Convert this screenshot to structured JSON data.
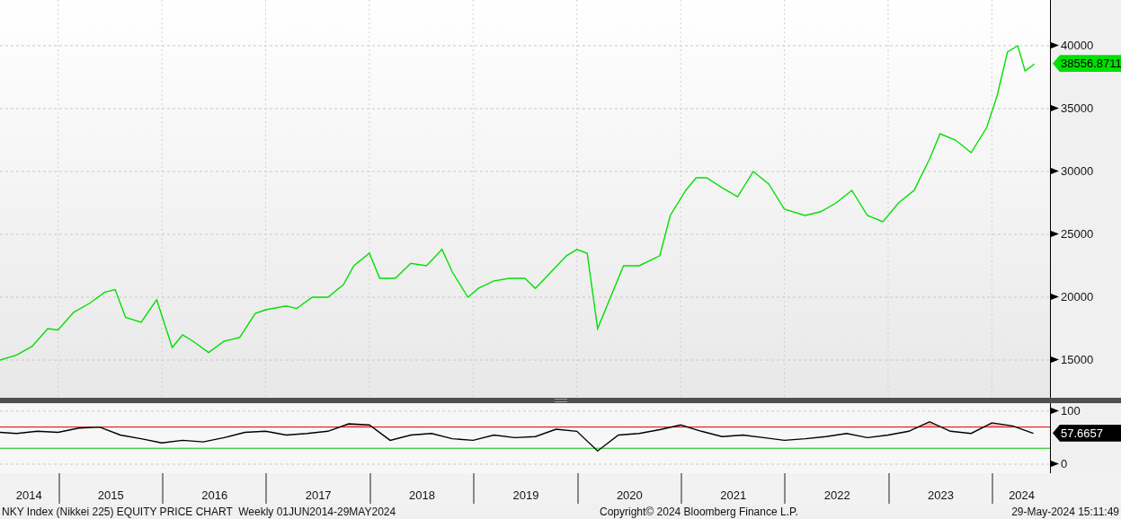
{
  "price_chart": {
    "last_value": "38556.8711",
    "chart_data": {
      "type": "line",
      "xlim": [
        2014.44,
        2024.56
      ],
      "ylim": [
        12000,
        43640
      ],
      "yticks": [
        15000,
        20000,
        25000,
        30000,
        35000,
        40000
      ],
      "grid": true,
      "x": [
        2014.44,
        2014.6,
        2014.75,
        2014.9,
        2015.0,
        2015.15,
        2015.3,
        2015.45,
        2015.55,
        2015.65,
        2015.8,
        2015.95,
        2016.1,
        2016.2,
        2016.3,
        2016.45,
        2016.6,
        2016.75,
        2016.9,
        2017.0,
        2017.2,
        2017.3,
        2017.45,
        2017.6,
        2017.75,
        2017.85,
        2018.0,
        2018.1,
        2018.25,
        2018.4,
        2018.55,
        2018.7,
        2018.8,
        2018.95,
        2019.05,
        2019.2,
        2019.35,
        2019.5,
        2019.6,
        2019.75,
        2019.9,
        2020.0,
        2020.1,
        2020.2,
        2020.3,
        2020.45,
        2020.6,
        2020.8,
        2020.9,
        2021.05,
        2021.15,
        2021.25,
        2021.4,
        2021.55,
        2021.7,
        2021.85,
        2022.0,
        2022.2,
        2022.35,
        2022.5,
        2022.65,
        2022.8,
        2022.95,
        2023.1,
        2023.25,
        2023.4,
        2023.5,
        2023.65,
        2023.8,
        2023.95,
        2024.05,
        2024.15,
        2024.25,
        2024.32,
        2024.41
      ],
      "series": [
        {
          "color": "#00e000",
          "values": [
            15000,
            15400,
            16100,
            17500,
            17400,
            18800,
            19500,
            20400,
            20600,
            18400,
            18000,
            19800,
            16000,
            17000,
            16500,
            15600,
            16500,
            16800,
            18700,
            19000,
            19300,
            19100,
            20000,
            20000,
            21000,
            22500,
            23500,
            21500,
            21500,
            22700,
            22500,
            23800,
            22000,
            20000,
            20700,
            21300,
            21500,
            21500,
            20700,
            22000,
            23300,
            23800,
            23500,
            17500,
            19500,
            22500,
            22500,
            23300,
            26500,
            28500,
            29500,
            29500,
            28700,
            28000,
            30000,
            29000,
            27000,
            26500,
            26800,
            27500,
            28500,
            26500,
            26000,
            27500,
            28500,
            31000,
            33000,
            32500,
            31500,
            33500,
            36000,
            39500,
            40000,
            38000,
            38557
          ]
        }
      ]
    }
  },
  "indicator_chart": {
    "last_value": "57.6657",
    "partial_year_label": "2014",
    "chart_data": {
      "type": "line",
      "xlim": [
        2014.44,
        2024.56
      ],
      "ylim": [
        -17,
        115
      ],
      "yticks": [
        0,
        100
      ],
      "grid": true,
      "xticks": [
        {
          "value": 2015.5,
          "label": "2015"
        },
        {
          "value": 2016.5,
          "label": "2016"
        },
        {
          "value": 2017.5,
          "label": "2017"
        },
        {
          "value": 2018.5,
          "label": "2018"
        },
        {
          "value": 2019.5,
          "label": "2019"
        },
        {
          "value": 2020.5,
          "label": "2020"
        },
        {
          "value": 2021.5,
          "label": "2021"
        },
        {
          "value": 2022.5,
          "label": "2022"
        },
        {
          "value": 2023.5,
          "label": "2023"
        },
        {
          "value": 2024.28,
          "label": "2024"
        }
      ],
      "ref_lines": [
        {
          "axis": "y",
          "value": 70,
          "color": "#e00000"
        },
        {
          "axis": "y",
          "value": 30,
          "color": "#00c000"
        }
      ],
      "x": [
        2014.44,
        2014.6,
        2014.8,
        2015.0,
        2015.2,
        2015.4,
        2015.6,
        2015.8,
        2016.0,
        2016.2,
        2016.4,
        2016.6,
        2016.8,
        2017.0,
        2017.2,
        2017.4,
        2017.6,
        2017.8,
        2018.0,
        2018.2,
        2018.4,
        2018.6,
        2018.8,
        2019.0,
        2019.2,
        2019.4,
        2019.6,
        2019.8,
        2020.0,
        2020.2,
        2020.4,
        2020.6,
        2020.8,
        2021.0,
        2021.2,
        2021.4,
        2021.6,
        2021.8,
        2022.0,
        2022.2,
        2022.4,
        2022.6,
        2022.8,
        2023.0,
        2023.2,
        2023.4,
        2023.6,
        2023.8,
        2024.0,
        2024.2,
        2024.4
      ],
      "series": [
        {
          "color": "#000000",
          "values": [
            60,
            58,
            62,
            60,
            68,
            70,
            55,
            48,
            40,
            45,
            42,
            50,
            60,
            62,
            55,
            58,
            62,
            76,
            74,
            45,
            55,
            58,
            48,
            45,
            55,
            50,
            52,
            66,
            62,
            25,
            55,
            58,
            65,
            74,
            62,
            52,
            55,
            50,
            45,
            48,
            52,
            58,
            50,
            55,
            62,
            80,
            62,
            58,
            78,
            72,
            58
          ]
        }
      ]
    }
  },
  "footer": {
    "title": "NKY Index (Nikkei 225) EQUITY PRICE CHART  Weekly 01JUN2014-29MAY2024",
    "copyright": "Copyright© 2024 Bloomberg Finance L.P.",
    "timestamp": "29-May-2024 15:11:49"
  }
}
